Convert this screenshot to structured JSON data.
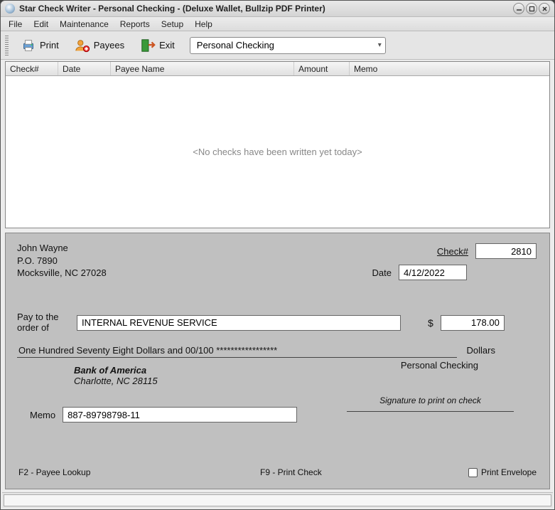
{
  "window": {
    "title": "Star Check Writer - Personal Checking - (Deluxe Wallet, Bullzip PDF Printer)"
  },
  "menu": {
    "file": "File",
    "edit": "Edit",
    "maintenance": "Maintenance",
    "reports": "Reports",
    "setup": "Setup",
    "help": "Help"
  },
  "toolbar": {
    "print": "Print",
    "payees": "Payees",
    "exit": "Exit",
    "account_selected": "Personal Checking"
  },
  "grid": {
    "columns": {
      "checknum": "Check#",
      "date": "Date",
      "payee": "Payee Name",
      "amount": "Amount",
      "memo": "Memo"
    },
    "empty_message": "<No checks have been written yet today>"
  },
  "check": {
    "holder_name": "John Wayne",
    "holder_addr1": "P.O. 7890",
    "holder_addr2": "Mocksville, NC  27028",
    "checknum_label": "Check#",
    "checknum": "2810",
    "date_label": "Date",
    "date": "4/12/2022",
    "payto_label_l1": "Pay to the",
    "payto_label_l2": "order of",
    "payee": "INTERNAL REVENUE SERVICE",
    "dollar_sign": "$",
    "amount": "178.00",
    "amount_words": "One Hundred Seventy Eight Dollars and 00/100 *****************",
    "dollars_label": "Dollars",
    "bank_name": "Bank of America",
    "bank_city": "Charlotte, NC 28115",
    "account_type": "Personal Checking",
    "signature_label": "Signature to print on check",
    "memo_label": "Memo",
    "memo": "887-89798798-11",
    "hint_lookup": "F2 - Payee Lookup",
    "hint_print": "F9 - Print Check",
    "print_envelope_label": "Print Envelope"
  }
}
